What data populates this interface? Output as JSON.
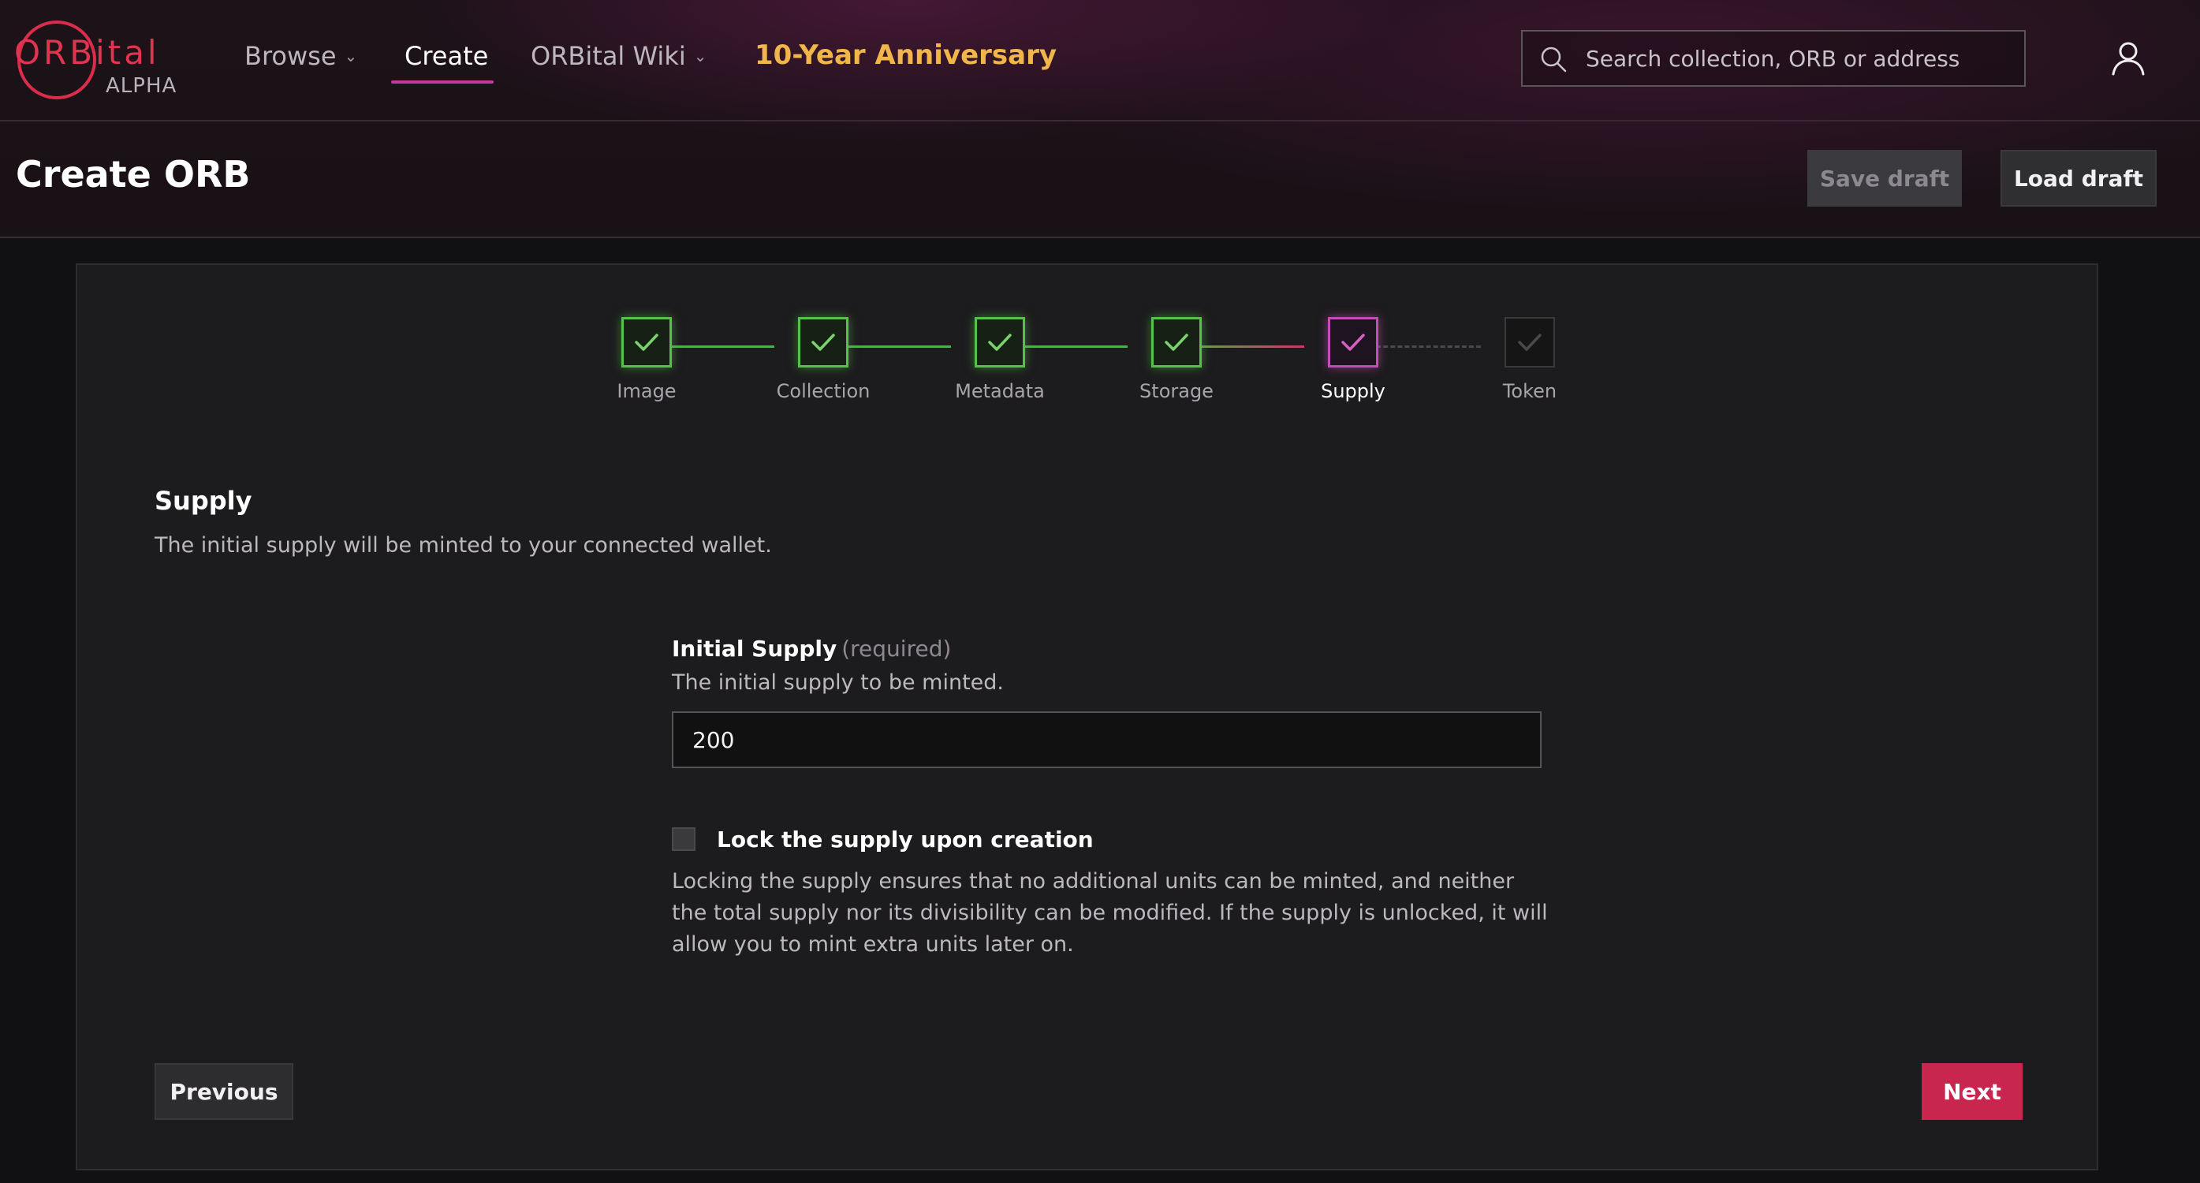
{
  "logo": {
    "wordmark": "ORBital",
    "tag": "ALPHA"
  },
  "nav": {
    "browse": "Browse",
    "create": "Create",
    "wiki": "ORBital Wiki",
    "anniversary": "10-Year Anniversary"
  },
  "search": {
    "placeholder": "Search collection, ORB or address"
  },
  "header": {
    "title": "Create ORB",
    "save_draft": "Save draft",
    "load_draft": "Load draft"
  },
  "steps": [
    {
      "label": "Image",
      "state": "done"
    },
    {
      "label": "Collection",
      "state": "done"
    },
    {
      "label": "Metadata",
      "state": "done"
    },
    {
      "label": "Storage",
      "state": "done"
    },
    {
      "label": "Supply",
      "state": "current"
    },
    {
      "label": "Token",
      "state": "todo"
    }
  ],
  "section": {
    "title": "Supply",
    "description": "The initial supply will be minted to your connected wallet."
  },
  "initial_supply": {
    "label": "Initial Supply",
    "required": "(required)",
    "help": "The initial supply to be minted.",
    "value": "200"
  },
  "lock": {
    "label": "Lock the supply upon creation",
    "checked": false,
    "help": "Locking the supply ensures that no additional units can be minted, and neither the total supply nor its divisibility can be modified. If the supply is unlocked, it will allow you to mint extra units later on."
  },
  "footer": {
    "previous": "Previous",
    "next": "Next"
  },
  "colors": {
    "accent_red": "#c8264f",
    "done_green": "#58c04c",
    "current_purple": "#c04fb1",
    "anniversary_gold": "#f0b64a"
  }
}
